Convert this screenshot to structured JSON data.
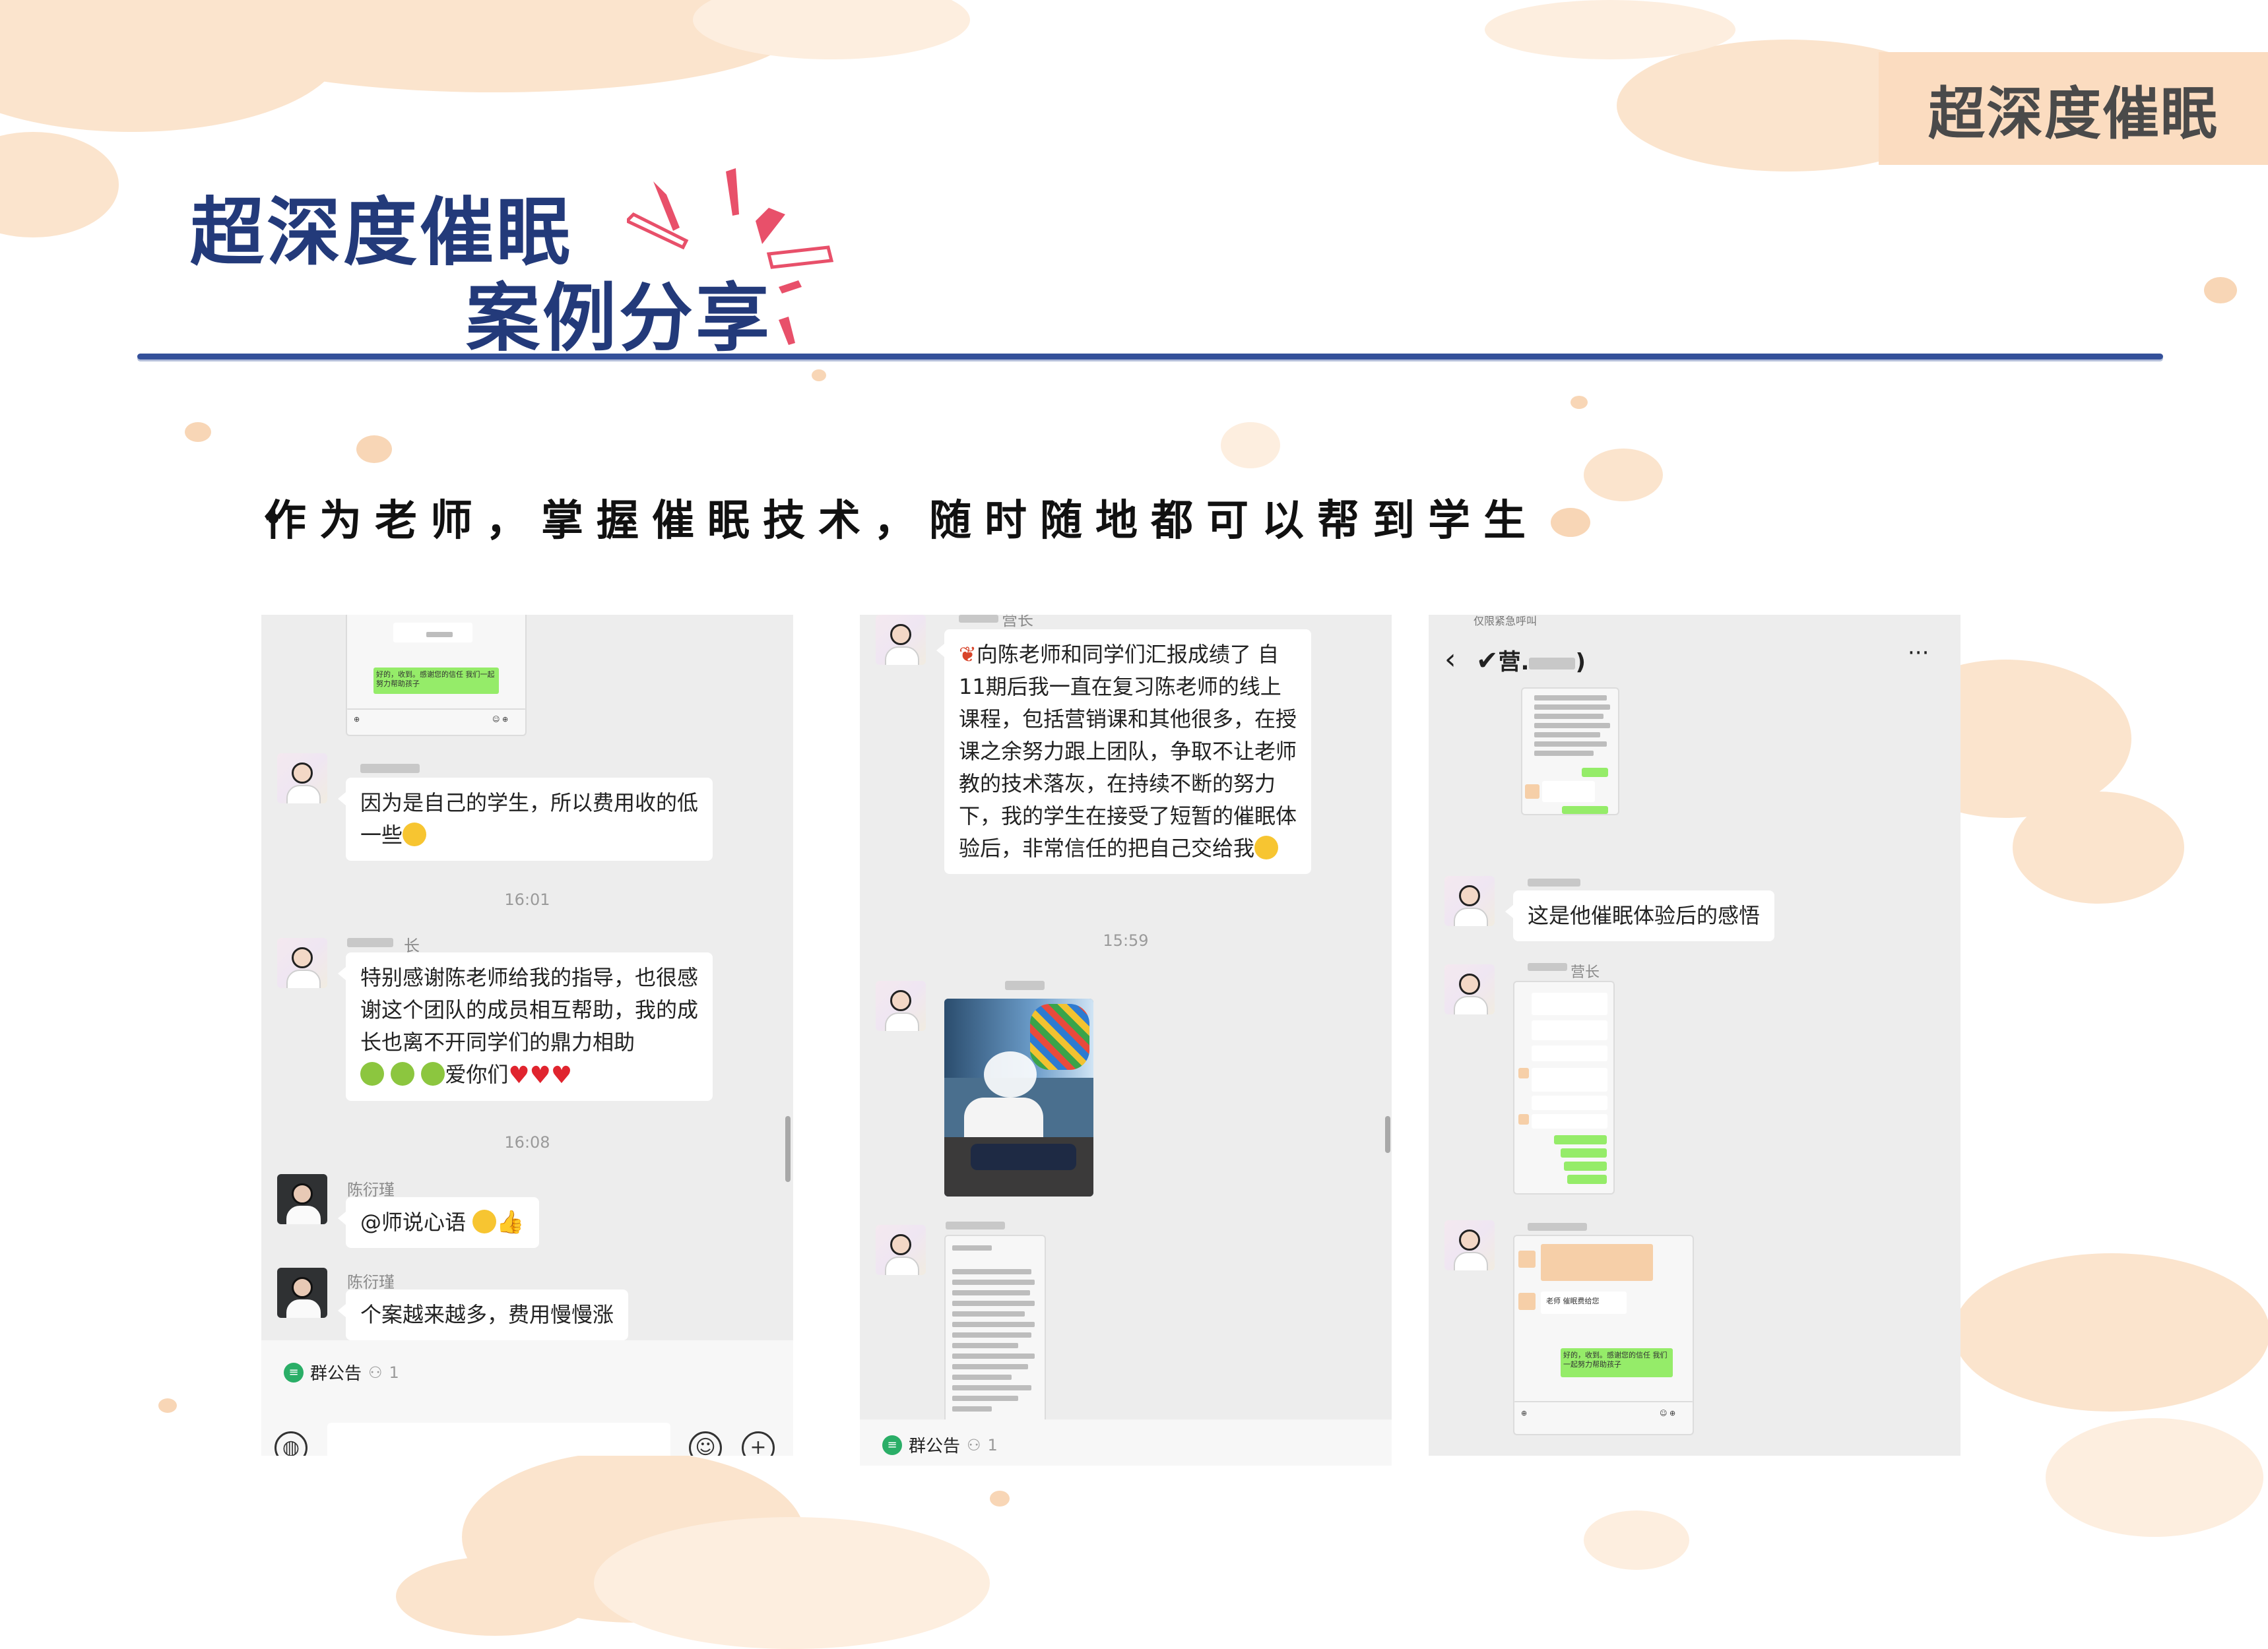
{
  "slide": {
    "corner_tag": "超深度催眠",
    "title_line1": "超深度催眠",
    "title_line2": "案例分享",
    "bullet": "作为老师，掌握催眠技术，随时随地都可以帮到学生"
  },
  "colors": {
    "title": "#233a7a",
    "accent_sparks": "#e8506a",
    "tag_bg": "#fbdcc0",
    "splash": "#fbe4cd",
    "chat_bg": "#ededed",
    "wechat_green": "#95ec69"
  },
  "screenshot1": {
    "mini_text": "好的，收到。感谢您的信任 我们一起努力帮助孩子",
    "msg1": "因为是自己的学生，所以费用收的低一些",
    "time1": "16:01",
    "sender2": "长",
    "msg2": "特别感谢陈老师给我的指导，也很感谢这个团队的成员相互帮助，我的成长也离不开同学们的鼎力相助",
    "msg2_tail": "爱你们",
    "time2": "16:08",
    "sender3": "陈衍瑾",
    "msg3": "@师说心语",
    "sender4": "陈衍瑾",
    "msg4": "个案越来越多，费用慢慢涨",
    "notice_label": "群公告",
    "notice_count": "1"
  },
  "screenshot2": {
    "sender1": "营长",
    "msg1": "向陈老师和同学们汇报成绩了 自11期后我一直在复习陈老师的线上课程，包括营销课和其他很多，在授课之余努力跟上团队，争取不让老师教的技术落灰，在持续不断的努力下，我的学生在接受了短暂的催眠体验后，非常信任的把自己交给我",
    "time1": "15:59",
    "notice_label": "群公告",
    "notice_count": "1"
  },
  "screenshot3": {
    "status_left": "仅限紧急呼叫",
    "header_title": "营.",
    "header_suffix": ")",
    "msg1": "这是他催眠体验后的感悟",
    "sender2": "营长",
    "mini_text": "好的，收到。感谢您的信任 我们一起努力帮助孩子",
    "mini_text2": "老师 催眠费给您"
  },
  "icons": [
    "spark-lines",
    "avatar-icon",
    "back-chevron-icon",
    "more-icon",
    "voice-icon",
    "emoji-icon",
    "plus-icon",
    "notice-icon",
    "member-icon",
    "heart-icon",
    "thumbs-up-icon",
    "grin-emoji-icon"
  ]
}
